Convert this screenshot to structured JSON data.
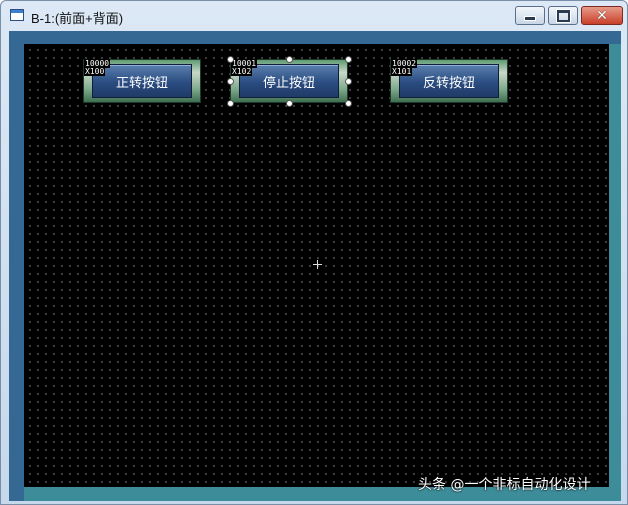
{
  "window": {
    "title": "B-1:(前面+背面)",
    "minimize_glyph": "minimize-icon",
    "maximize_glyph": "maximize-icon",
    "close_glyph": "✕"
  },
  "buttons": [
    {
      "label": "正转按钮",
      "address": "10000",
      "bit": "X100"
    },
    {
      "label": "停止按钮",
      "address": "10001",
      "bit": "X102",
      "selected": true
    },
    {
      "label": "反转按钮",
      "address": "10002",
      "bit": "X101"
    }
  ],
  "colors": {
    "canvas_background": "#000000",
    "button_face": "#2a4c80",
    "frame_accent": "#3d8c9a"
  },
  "watermark": "头条 @一个非标自动化设计"
}
